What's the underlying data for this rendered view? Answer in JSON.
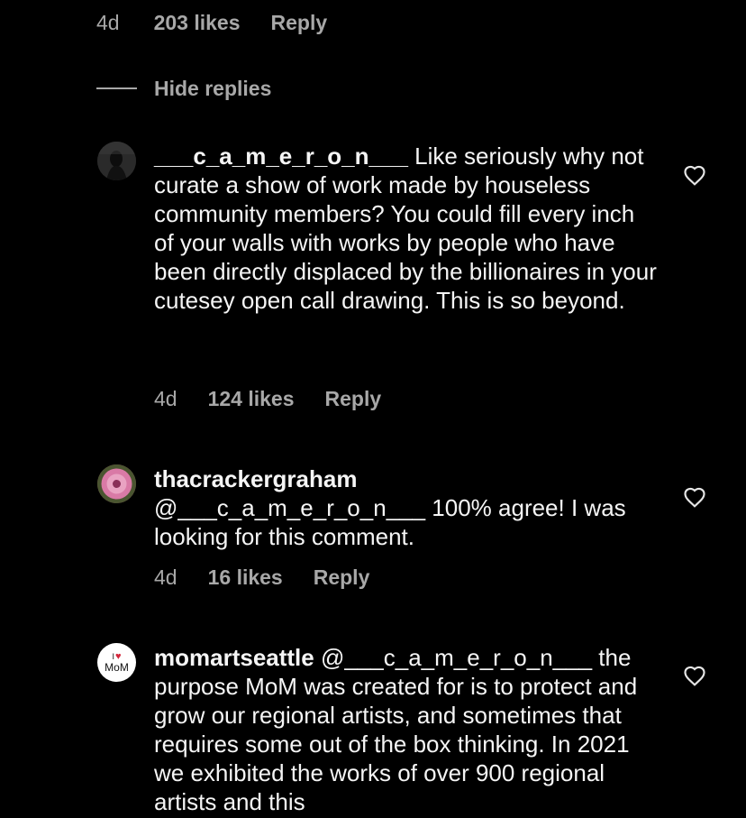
{
  "top_reply": {
    "time": "4d",
    "likes": "203 likes",
    "reply": "Reply"
  },
  "hide_replies": {
    "label": "Hide replies"
  },
  "comments": [
    {
      "username": "___c_a_m_e_r_o_n___",
      "text": " Like seriously why not curate a show of work made by houseless community members? You could fill every inch of your walls with works by people who have been directly displaced by the billionaires in your cutesey open call drawing. This is so beyond.",
      "time": "4d",
      "likes": "124 likes",
      "reply": "Reply",
      "avatar_icon": "user-photo-dark",
      "like_icon": "heart-outline-icon"
    },
    {
      "username": "thacrackergraham",
      "mention": "@___c_a_m_e_r_o_n___",
      "text": " 100% agree! I was looking for this comment.",
      "time": "4d",
      "likes": "16 likes",
      "reply": "Reply",
      "avatar_icon": "pink-flower-photo",
      "like_icon": "heart-outline-icon"
    },
    {
      "username": "momartseattle",
      "mention": "@___c_a_m_e_r_o_n___",
      "text": " the purpose MoM was created for is to protect and grow our regional artists, and sometimes that requires some out of the box thinking. In 2021 we exhibited the works of over 900 regional artists and this",
      "avatar_logo_text": "MoM",
      "avatar_logo_prefix": "I",
      "avatar_icon": "mom-logo",
      "like_icon": "heart-outline-icon"
    }
  ],
  "colors": {
    "background": "#000000",
    "primary_text": "#f5f5f5",
    "secondary_text": "#a8a8a8",
    "mom_heart": "#d3263b"
  }
}
